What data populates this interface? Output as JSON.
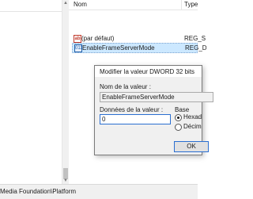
{
  "list": {
    "columns": {
      "name": "Nom",
      "type": "Type"
    },
    "rows": [
      {
        "icon": "string-value-icon",
        "glyph": "ab",
        "name": "(par défaut)",
        "type": "REG_S"
      },
      {
        "icon": "binary-value-icon",
        "glyph": "011",
        "name": "EnableFrameServerMode",
        "type": "REG_D"
      }
    ]
  },
  "status_bar": {
    "path": "Media Foundation\\Platform"
  },
  "dialog": {
    "title": "Modifier la valeur DWORD 32 bits",
    "name_label": "Nom de la valeur :",
    "name_value": "EnableFrameServerMode",
    "data_label": "Données de la valeur :",
    "data_value": "0",
    "base_label": "Base",
    "base_options": [
      {
        "label": "Hexad",
        "selected": true
      },
      {
        "label": "Décim",
        "selected": false
      }
    ],
    "ok_label": "OK"
  },
  "colors": {
    "selection": "#cce8ff",
    "accent": "#2b6fd1"
  }
}
